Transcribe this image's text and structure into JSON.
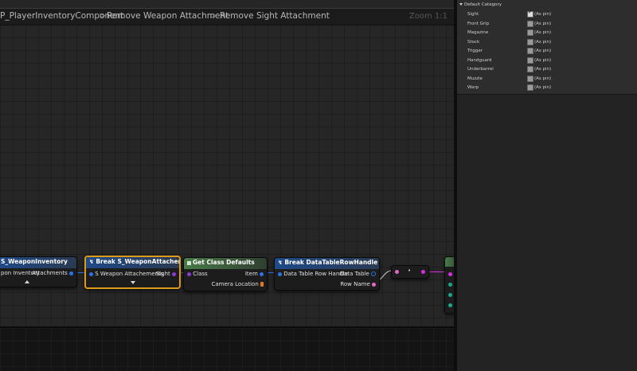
{
  "breadcrumb": {
    "item1": "P_PlayerInventoryComponent",
    "item2": "Remove Weapon Attachment",
    "item3": "Remove Sight Attachment",
    "sep": ">",
    "zoom": "Zoom 1:1"
  },
  "nodes": {
    "s_weapon_inventory": {
      "title": "S_WeaponInventory",
      "pin_in": "pon Inventory",
      "pin_out": "Attachments"
    },
    "break_weapon_attachments": {
      "title": "Break S_WeaponAttachements",
      "pin_in": "S Weapon Attachements",
      "pin_out": "Sight"
    },
    "get_class_defaults": {
      "title": "Get Class Defaults",
      "pin_class": "Class",
      "pin_item": "Item",
      "pin_camera": "Camera Location"
    },
    "break_datatable_row": {
      "title": "Break DataTableRowHandle",
      "pin_in": "Data Table Row Handle",
      "pin_datatable": "Data Table",
      "pin_rowname": "Row Name"
    },
    "reroute": {
      "label": "•"
    }
  },
  "details": {
    "category": "Default Category",
    "properties": [
      {
        "name": "Sight",
        "value": "(As pin)",
        "checked": true
      },
      {
        "name": "Front Grip",
        "value": "(As pin)",
        "checked": false
      },
      {
        "name": "Magazine",
        "value": "(As pin)",
        "checked": false
      },
      {
        "name": "Stock",
        "value": "(As pin)",
        "checked": false
      },
      {
        "name": "Trigger",
        "value": "(As pin)",
        "checked": false
      },
      {
        "name": "Handguard",
        "value": "(As pin)",
        "checked": false
      },
      {
        "name": "Underbarrel",
        "value": "(As pin)",
        "checked": false
      },
      {
        "name": "Muzzle",
        "value": "(As pin)",
        "checked": false
      },
      {
        "name": "Warp",
        "value": "(As pin)",
        "checked": false
      }
    ],
    "checkmark": "✓"
  },
  "colors": {
    "accent_selected": "#e09a1a",
    "struct_pin": "#2a74e6",
    "class_pin": "#8a3cd6",
    "name_pin": "#e06ac8"
  }
}
